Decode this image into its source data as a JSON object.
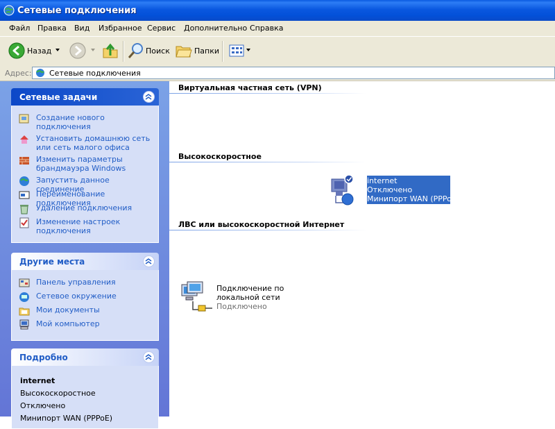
{
  "window": {
    "title": "Сетевые подключения",
    "icon": "network-connections-icon"
  },
  "menu": [
    "Файл",
    "Правка",
    "Вид",
    "Избранное",
    "Сервис",
    "Дополнительно",
    "Справка"
  ],
  "toolbar": {
    "back": "Назад",
    "search": "Поиск",
    "folders": "Папки"
  },
  "address": {
    "label": "Адрес:",
    "value": "Сетевые подключения"
  },
  "tasks": {
    "title": "Сетевые задачи",
    "items": [
      "Создание нового подключения",
      "Установить домашнюю сеть или сеть малого офиса",
      "Изменить параметры брандмауэра Windows",
      "Запустить данное соединение",
      "Переименование подключения",
      "Удаление подключения",
      "Изменение настроек подключения"
    ]
  },
  "places": {
    "title": "Другие места",
    "items": [
      "Панель управления",
      "Сетевое окружение",
      "Мои документы",
      "Мой компьютер"
    ]
  },
  "details": {
    "title": "Подробно",
    "name": "internet",
    "lines": [
      "Высокоскоростное",
      "Отключено",
      "Минипорт WAN (PPPoE)"
    ]
  },
  "groups": {
    "vpn": "Виртуальная частная сеть (VPN)",
    "broadband": "Высокоскоростное",
    "lan": "ЛВС или высокоскоростной Интернет"
  },
  "connections": {
    "internet": {
      "name": "internet",
      "status": "Отключено",
      "device": "Минипорт WAN (PPPoE)"
    },
    "lan": {
      "name": "Подключение по локальной сети",
      "status": "Подключено"
    }
  },
  "colors": {
    "link": "#215dc6",
    "pane_top": "#7ba2e7",
    "pane_bottom": "#6375d6",
    "selection": "#316ac5"
  }
}
